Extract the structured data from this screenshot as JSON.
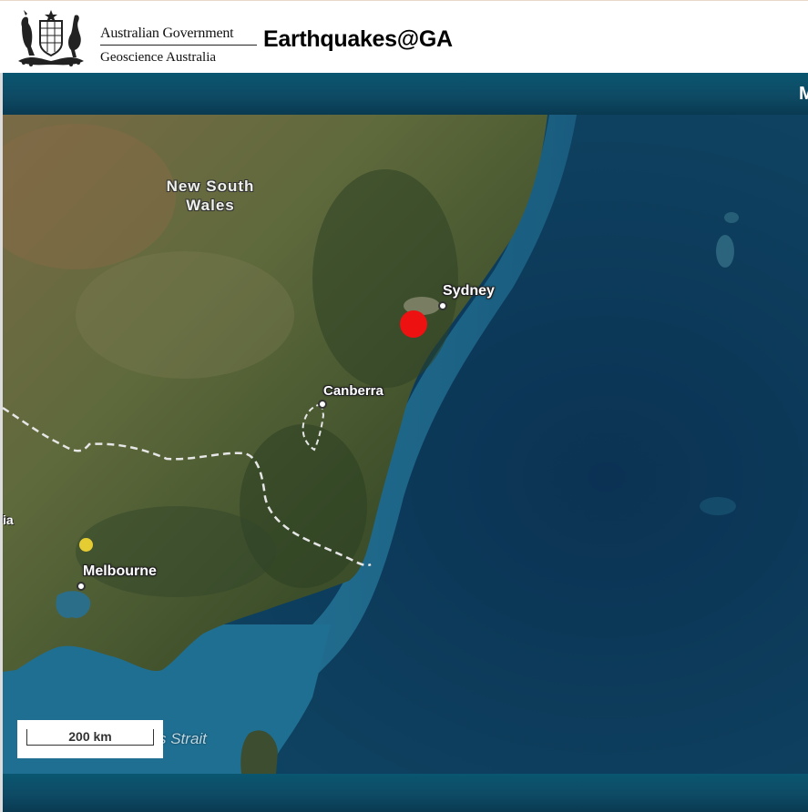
{
  "header": {
    "agency_line1": "Australian Government",
    "agency_line2": "Geoscience Australia",
    "app_title": "Earthquakes@GA"
  },
  "nav": {
    "menu_partial": "M"
  },
  "map": {
    "labels": {
      "state": "New South\nWales",
      "sydney": "Sydney",
      "canberra": "Canberra",
      "melbourne": "Melbourne",
      "strait": "s Strait",
      "edge_left": "ia"
    },
    "scale_label": "200 km",
    "colors": {
      "quake_large": "#ee1111",
      "quake_small": "#e6cc33",
      "ocean": "#0d3a5a",
      "land": "#4a5a30"
    },
    "earthquakes": [
      {
        "magnitude_class": "large",
        "color": "#ee1111"
      },
      {
        "magnitude_class": "small",
        "color": "#e6cc33"
      }
    ]
  }
}
